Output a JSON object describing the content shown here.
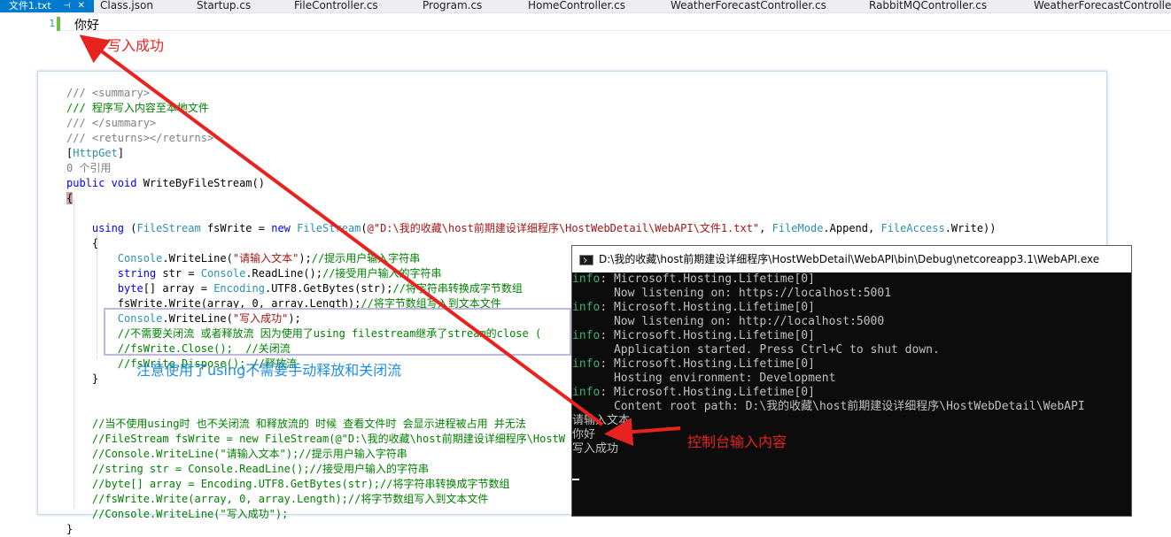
{
  "tabs": {
    "active": "文件1.txt",
    "pin_icon": "pin-icon",
    "close_icon": "close-icon",
    "items": [
      "Class.json",
      "Startup.cs",
      "FileController.cs",
      "Program.cs",
      "HomeController.cs",
      "WeatherForecastController.cs",
      "RabbitMQController.cs",
      "WeatherForecastController"
    ]
  },
  "editor": {
    "line_number": "1",
    "line_text": "你好"
  },
  "annotations": {
    "write_success": "写入成功",
    "console_input": "控制台输入内容",
    "using_note": "注意使用了using不需要手动释放和关闭流"
  },
  "code": {
    "l1": "/// <summary>",
    "l2": "/// 程序写入内容至本地文件",
    "l3": "/// </summary>",
    "l4": "/// <returns></returns>",
    "l5_open": "[",
    "l5_attr": "HttpGet",
    "l5_close": "]",
    "l6": "0 个引用",
    "l7_kw": "public void",
    "l7_rest": " WriteByFileStream()",
    "l8": "{",
    "l9_kw": "using",
    "l9_a": " (",
    "l9_t1": "FileStream",
    "l9_b": " fsWrite = ",
    "l9_new": "new",
    "l9_t2": "FileStream",
    "l9_c": "(",
    "l9_str": "@\"D:\\我的收藏\\host前期建设详细程序\\HostWebDetail\\WebAPI\\文件1.txt\"",
    "l9_d": ", ",
    "l9_t3": "FileMode",
    "l9_e": ".Append, ",
    "l9_t4": "FileAccess",
    "l9_f": ".Write))",
    "l10": "{",
    "l11_t": "Console",
    "l11_a": ".WriteLine(",
    "l11_s": "\"请输入文本\"",
    "l11_b": ");",
    "l11_c": "//提示用户输入字符串",
    "l12_kw": "string",
    "l12_a": " str = ",
    "l12_t": "Console",
    "l12_b": ".ReadLine();",
    "l12_c": "//接受用户输入的字符串",
    "l13_kw": "byte",
    "l13_a": "[] array = ",
    "l13_t": "Encoding",
    "l13_b": ".UTF8.GetBytes(str);",
    "l13_c": "//将字符串转换成字节数组",
    "l14_a": "fsWrite.Write(array, 0, array.Length);",
    "l14_c": "//将字节数组写入到文本文件",
    "l15_t": "Console",
    "l15_a": ".WriteLine(",
    "l15_s": "\"写入成功\"",
    "l15_b": ");",
    "l16": "//不需要关闭流 或者释放流 因为使用了using filestream继承了stream的close ( ",
    "l17": "//fsWrite.Close();  //关闭流",
    "l18": "//fsWrite.Dispose(); //释放流",
    "l19": "}",
    "l20": "//当不使用using时 也不关闭流 和释放流的 时候 查看文件时 会显示进程被占用 并无法",
    "l21": "//FileStream fsWrite = new FileStream(@\"D:\\我的收藏\\host前期建设详细程序\\HostW",
    "l22": "//Console.WriteLine(\"请输入文本\");//提示用户输入字符串",
    "l23": "//string str = Console.ReadLine();//接受用户输入的字符串",
    "l24": "//byte[] array = Encoding.UTF8.GetBytes(str);//将字符串转换成字节数组",
    "l25": "//fsWrite.Write(array, 0, array.Length);//将字节数组写入到文本文件",
    "l26": "//Console.WriteLine(\"写入成功\");",
    "l27": "}"
  },
  "console": {
    "title": "D:\\我的收藏\\host前期建设详细程序\\HostWebDetail\\WebAPI\\bin\\Debug\\netcoreapp3.1\\WebAPI.exe",
    "info_prefix": "info",
    "lines": [
      {
        "src": ": Microsoft.Hosting.Lifetime[0]",
        "msg": "      Now listening on: https://localhost:5001"
      },
      {
        "src": ": Microsoft.Hosting.Lifetime[0]",
        "msg": "      Now listening on: http://localhost:5000"
      },
      {
        "src": ": Microsoft.Hosting.Lifetime[0]",
        "msg": "      Application started. Press Ctrl+C to shut down."
      },
      {
        "src": ": Microsoft.Hosting.Lifetime[0]",
        "msg": "      Hosting environment: Development"
      },
      {
        "src": ": Microsoft.Hosting.Lifetime[0]",
        "msg": "      Content root path: D:\\我的收藏\\host前期建设详细程序\\HostWebDetail\\WebAPI"
      }
    ],
    "out1": "请输入文本",
    "out2": "你好",
    "out3": "写入成功"
  },
  "colors": {
    "accent": "#007acc",
    "annotation_red": "#e8231f",
    "annotation_blue": "#1f8ee0",
    "console_bg": "#0c0c0c",
    "info_green": "#3cb371"
  }
}
